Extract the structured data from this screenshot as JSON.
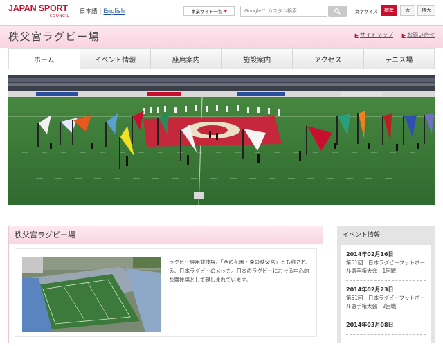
{
  "header": {
    "logo_main": "JAPAN SPORT",
    "logo_sub": "COUNCIL",
    "lang_ja": "日本語",
    "lang_sep": "|",
    "lang_en": "English",
    "business_sites_label": "事業サイト一覧",
    "search_placeholder": "Google™ カスタム検索",
    "font_size_label": "文字サイズ",
    "font_sizes": [
      "標準",
      "大",
      "特大"
    ],
    "accent_color": "#c8102e"
  },
  "title_band": {
    "site_title": "秩父宮ラグビー場",
    "sitemap_label": "サイトマップ",
    "contact_label": "お問い合せ"
  },
  "nav": {
    "items": [
      "ホーム",
      "イベント情報",
      "座席案内",
      "施設案内",
      "アクセス",
      "テニス場"
    ],
    "active_index": 0
  },
  "main": {
    "heading": "秩父宮ラグビー場",
    "description": "ラグビー専用競技場。「西の花園・東の秩父宮」とも称される、日本ラグビーのメッカ。日本のラグビーにおける中心的な競技場として親しまれています。"
  },
  "side": {
    "heading": "イベント情報",
    "events": [
      {
        "date": "2014年02月16日",
        "title": "第51回　日本ラグビーフットボール選手権大会　1回戦"
      },
      {
        "date": "2014年02月23日",
        "title": "第51回　日本ラグビーフットボール選手権大会　2回戦"
      },
      {
        "date": "2014年03月08日",
        "title": ""
      }
    ]
  }
}
